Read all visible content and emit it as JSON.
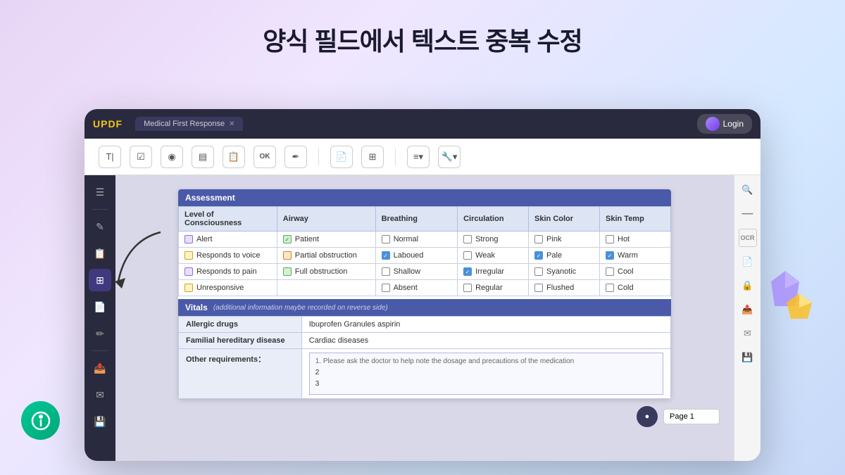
{
  "page": {
    "title": "양식 필드에서 텍스트 중복 수정",
    "app_name": "UPDF",
    "tab_label": "Medical First Response",
    "login_label": "Login"
  },
  "toolbar": {
    "tools": [
      {
        "name": "text-tool",
        "icon": "T|",
        "label": "Text"
      },
      {
        "name": "checkbox-tool",
        "icon": "☑",
        "label": "Checkbox"
      },
      {
        "name": "radio-tool",
        "icon": "◉",
        "label": "Radio"
      },
      {
        "name": "text-field-tool",
        "icon": "▤",
        "label": "Text Field"
      },
      {
        "name": "list-tool",
        "icon": "≡",
        "label": "List"
      },
      {
        "name": "ok-tool",
        "icon": "OK",
        "label": "OK"
      },
      {
        "name": "sign-tool",
        "icon": "✒",
        "label": "Sign"
      },
      {
        "name": "doc-tool",
        "icon": "📄",
        "label": "Document"
      },
      {
        "name": "grid-tool",
        "icon": "⊞",
        "label": "Grid"
      },
      {
        "name": "align-tool",
        "icon": "≡",
        "label": "Align"
      },
      {
        "name": "wrench-tool",
        "icon": "🔧",
        "label": "Settings"
      }
    ]
  },
  "assessment": {
    "section_label": "Assessment",
    "columns": {
      "consciousness": "Level of Consciousness",
      "airway": "Airway",
      "breathing": "Breathing",
      "circulation": "Circulation",
      "skin_color": "Skin Color",
      "skin_temp": "Skin Temp"
    },
    "consciousness_items": [
      {
        "label": "Alert",
        "checked": false,
        "type": "purple"
      },
      {
        "label": "Responds to voice",
        "checked": true,
        "type": "yellow"
      },
      {
        "label": "Responds to pain",
        "checked": false,
        "type": "purple"
      },
      {
        "label": "Unresponsive",
        "checked": false,
        "type": "purple"
      }
    ],
    "airway_items": [
      {
        "label": "Patient",
        "checked": true,
        "type": "green"
      },
      {
        "label": "Partial obstruction",
        "checked": false,
        "type": "orange"
      },
      {
        "label": "Full obstruction",
        "checked": false,
        "type": "green"
      }
    ],
    "breathing_items": [
      {
        "label": "Normal",
        "checked": false
      },
      {
        "label": "Laboued",
        "checked": true,
        "type": "blue"
      },
      {
        "label": "Shallow",
        "checked": false
      },
      {
        "label": "Absent",
        "checked": false
      }
    ],
    "circulation_items": [
      {
        "label": "Strong",
        "checked": false
      },
      {
        "label": "Weak",
        "checked": false
      },
      {
        "label": "Irregular",
        "checked": true,
        "type": "blue"
      },
      {
        "label": "Regular",
        "checked": false
      }
    ],
    "skin_color_items": [
      {
        "label": "Pink",
        "checked": false
      },
      {
        "label": "Pale",
        "checked": true,
        "type": "blue"
      },
      {
        "label": "Syanotic",
        "checked": false
      },
      {
        "label": "Flushed",
        "checked": false
      }
    ],
    "skin_temp_items": [
      {
        "label": "Hot",
        "checked": false
      },
      {
        "label": "Warm",
        "checked": true,
        "type": "blue"
      },
      {
        "label": "Cool",
        "checked": false
      },
      {
        "label": "Cold",
        "checked": false
      }
    ]
  },
  "vitals": {
    "section_label": "Vitals",
    "note": "(additional information maybe recorded on reverse side)",
    "allergic_drugs_label": "Allergic drugs",
    "allergic_drugs_value": "Ibuprofen Granules  aspirin",
    "familial_label": "Familial hereditary disease",
    "familial_value": "Cardiac diseases",
    "other_label": "Other requirements：",
    "other_lines": [
      "1. Please ask the doctor to help note the dosage and precautions of the medication",
      "2",
      "3"
    ]
  },
  "sidebar": {
    "left_icons": [
      "☰",
      "✎",
      "📋",
      "⊞",
      "📄",
      "🔧",
      "📤",
      "✉",
      "💾"
    ],
    "right_icons": [
      "🔍",
      "—",
      "OCR",
      "📄",
      "🔒",
      "📤",
      "✉",
      "💾"
    ]
  }
}
